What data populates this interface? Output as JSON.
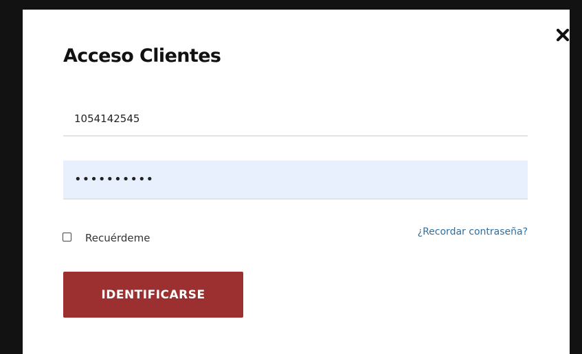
{
  "modal": {
    "title": "Acceso Clientes",
    "close_icon": "close-icon"
  },
  "form": {
    "username_value": "1054142545",
    "password_value": "••••••••••",
    "remember_label": "Recuérdeme",
    "remember_checked": false,
    "forgot_link": "¿Recordar contraseña?",
    "submit_label": "IDENTIFICARSE"
  },
  "colors": {
    "submit_bg": "#9c2f2f",
    "password_autofill_bg": "#e8f0fe",
    "link": "#2e6fa0",
    "backdrop": "#121212"
  }
}
